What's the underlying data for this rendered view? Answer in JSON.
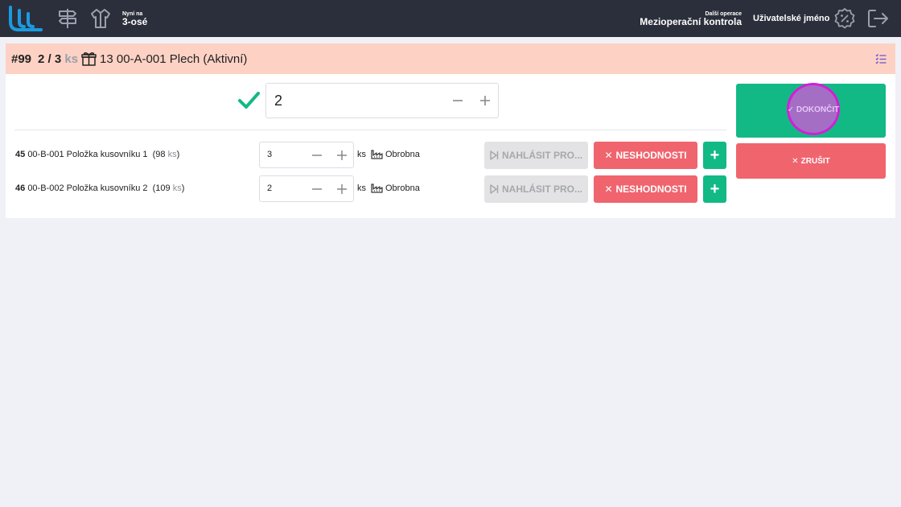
{
  "header": {
    "now_label": "Nyní na",
    "now_value": "3-osé",
    "next_label": "Další operace",
    "next_value": "Mezioperační kontrola",
    "username": "Uživatelské jméno",
    "icons": [
      "logo",
      "signpost-icon",
      "workwear-icon",
      "settings-badge-icon",
      "logout-icon"
    ]
  },
  "order": {
    "number": "#99",
    "qty_done": "2",
    "qty_sep": "/",
    "qty_total": "3",
    "unit": "ks",
    "product": "13 00-A-001 Plech (Aktivní)"
  },
  "main_input": {
    "value": "2"
  },
  "rows": [
    {
      "pos": "45",
      "name": "00-B-001 Položka kusovníku 1",
      "stock_open": "(98",
      "stock_unit": "ks",
      "stock_close": ")",
      "qty": "3",
      "unit": "ks",
      "place": "Obrobna",
      "report_label": "NAHLÁSIT PRO...",
      "nonconf_label": "NESHODNOSTI",
      "add_label": "+"
    },
    {
      "pos": "46",
      "name": "00-B-002 Položka kusovníku 2",
      "stock_open": "(109",
      "stock_unit": "ks",
      "stock_close": ")",
      "qty": "2",
      "unit": "ks",
      "place": "Obrobna",
      "report_label": "NAHLÁSIT PRO...",
      "nonconf_label": "NESHODNOSTI",
      "add_label": "+"
    }
  ],
  "actions": {
    "finish_label": "✓ DOKONČIT",
    "cancel_label": "ZRUŠIT",
    "cancel_icon": "✕"
  },
  "colors": {
    "topbar": "#2b2f3b",
    "orderbar": "#fdd2c4",
    "green": "#12b985",
    "red": "#f0646e",
    "accent_blue": "#1a9be0",
    "highlight": "#d21fd6"
  }
}
